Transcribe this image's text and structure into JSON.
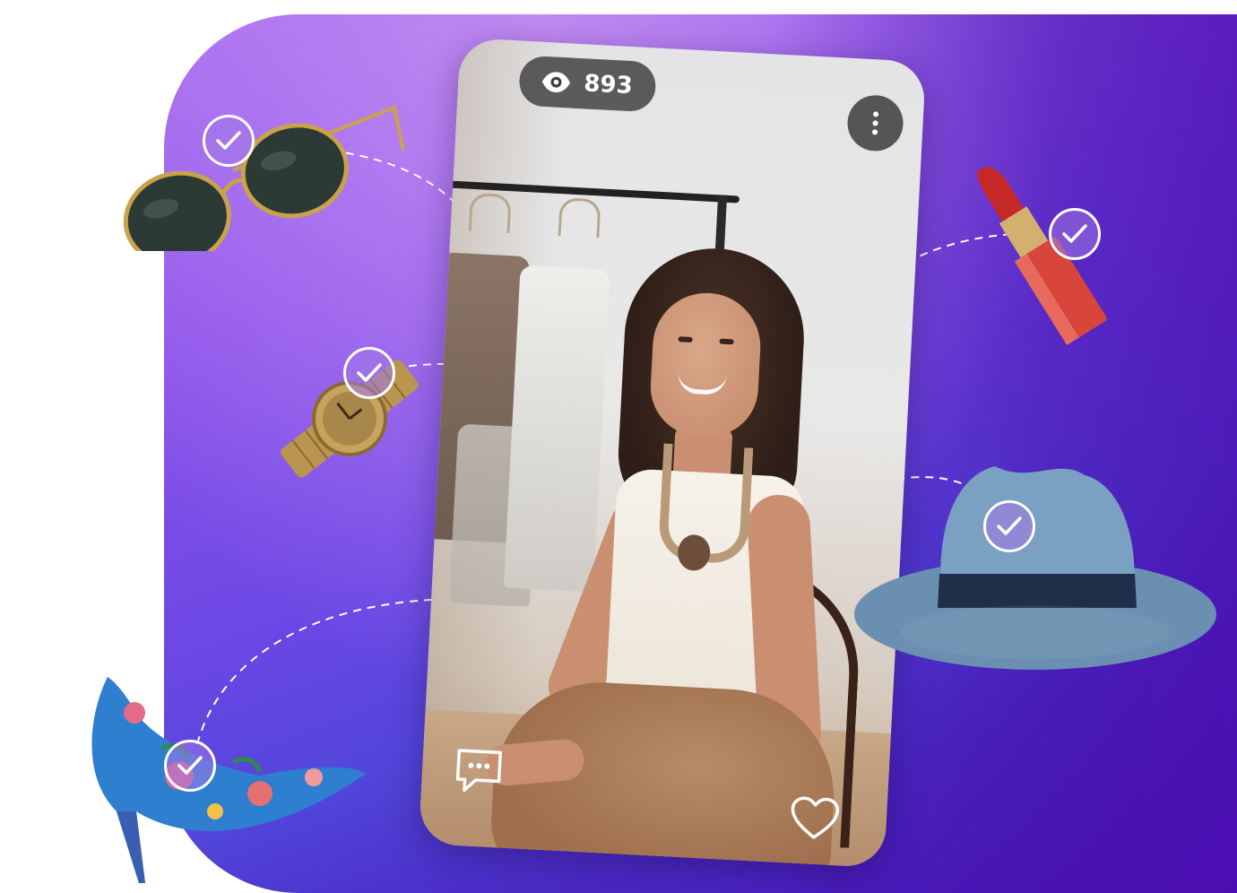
{
  "post": {
    "views_count": "893",
    "icons": {
      "views": "eye-icon",
      "more": "more-vertical-icon",
      "comment": "comment-icon",
      "like": "heart-icon"
    }
  },
  "tagged_products": [
    {
      "name": "sunglasses",
      "icon": "check-icon"
    },
    {
      "name": "watch",
      "icon": "check-icon"
    },
    {
      "name": "high-heel-shoe",
      "icon": "check-icon"
    },
    {
      "name": "lipstick",
      "icon": "check-icon"
    },
    {
      "name": "fedora-hat",
      "icon": "check-icon"
    }
  ],
  "colors": {
    "background_gradient_start": "#a46cf0",
    "background_gradient_end": "#4a10b7",
    "pill_background": "#3c3c3e",
    "badge_tint": "#a078e6"
  }
}
